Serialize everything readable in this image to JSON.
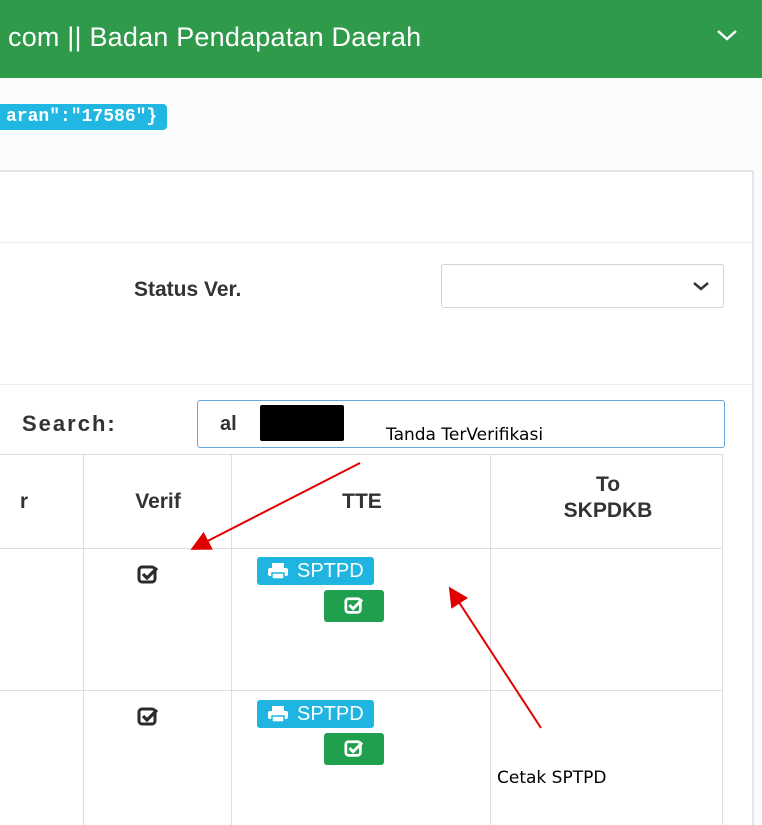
{
  "header": {
    "title": "com || Badan Pendapatan Daerah"
  },
  "debug_badge": {
    "text": "aran\":\"17586\"}"
  },
  "filters": {
    "status_label": "Status Ver.",
    "status_value": ""
  },
  "search": {
    "label": "Search:",
    "value": "al"
  },
  "table": {
    "columns": {
      "partial": "r",
      "verif": "Verif",
      "tte": "TTE",
      "to_skpdkb_line1": "To",
      "to_skpdkb_line2": "SKPDKB"
    },
    "rows": [
      {
        "sptpd_label": "SPTPD"
      },
      {
        "sptpd_label": "SPTPD"
      }
    ]
  },
  "annotations": {
    "verified": "Tanda TerVerifikasi",
    "print": "Cetak SPTPD"
  },
  "colors": {
    "header_green": "#2f9a4a",
    "badge_cyan": "#20b8e2",
    "button_cyan": "#1fb5e0",
    "button_green": "#20a04e",
    "arrow_red": "#e00000"
  }
}
